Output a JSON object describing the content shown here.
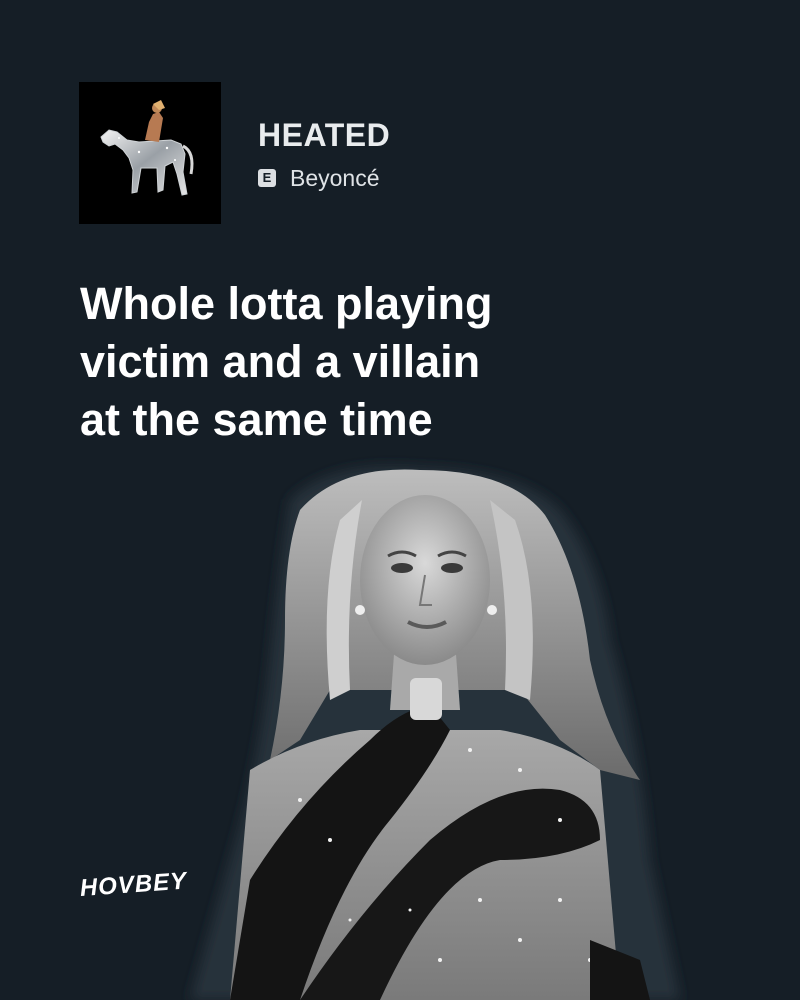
{
  "song": {
    "title": "HEATED",
    "explicit_badge": "E",
    "artist": "Beyoncé",
    "cover_art_icon": "album-cover-horse-rider"
  },
  "lyric": {
    "lines": [
      "Whole lotta playing",
      "victim and a villain",
      "at the same time"
    ]
  },
  "photo": {
    "subject_icon": "performer-photo-black-white"
  },
  "brand": {
    "logo_text": "HOVBEY"
  },
  "colors": {
    "background": "#151e26",
    "text": "#ffffff",
    "badge": "#dcdfe2"
  }
}
